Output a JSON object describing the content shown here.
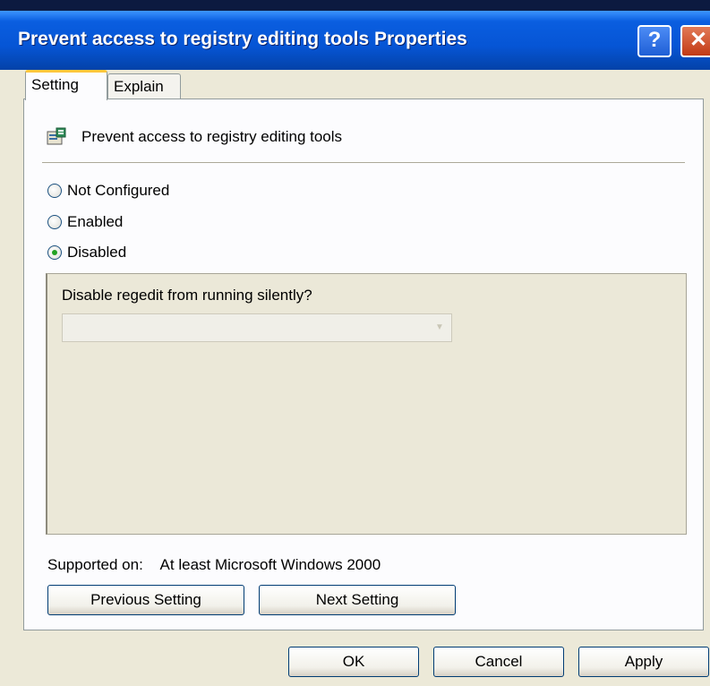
{
  "window": {
    "title": "Prevent access to registry editing tools Properties",
    "help_label": "?",
    "close_label": "✕"
  },
  "tabs": [
    {
      "label": "Setting",
      "selected": true
    },
    {
      "label": "Explain",
      "selected": false
    }
  ],
  "policy": {
    "icon": "policy-setting-icon",
    "title": "Prevent access to registry editing tools"
  },
  "options": [
    {
      "label": "Not Configured",
      "checked": false
    },
    {
      "label": "Enabled",
      "checked": false
    },
    {
      "label": "Disabled",
      "checked": true
    }
  ],
  "policy_options": {
    "question": "Disable regedit from running silently?",
    "dropdown_value": ""
  },
  "supported": {
    "label": "Supported on:",
    "value": "At least Microsoft Windows 2000"
  },
  "nav_buttons": {
    "previous": "Previous Setting",
    "next": "Next Setting"
  },
  "footer_buttons": {
    "ok": "OK",
    "cancel": "Cancel",
    "apply": "Apply"
  },
  "colors": {
    "titlebar": "#0655d5",
    "dialog_bg": "#ece9d8",
    "selected_radio": "#21a121",
    "tab_accent": "#ffc73c"
  }
}
